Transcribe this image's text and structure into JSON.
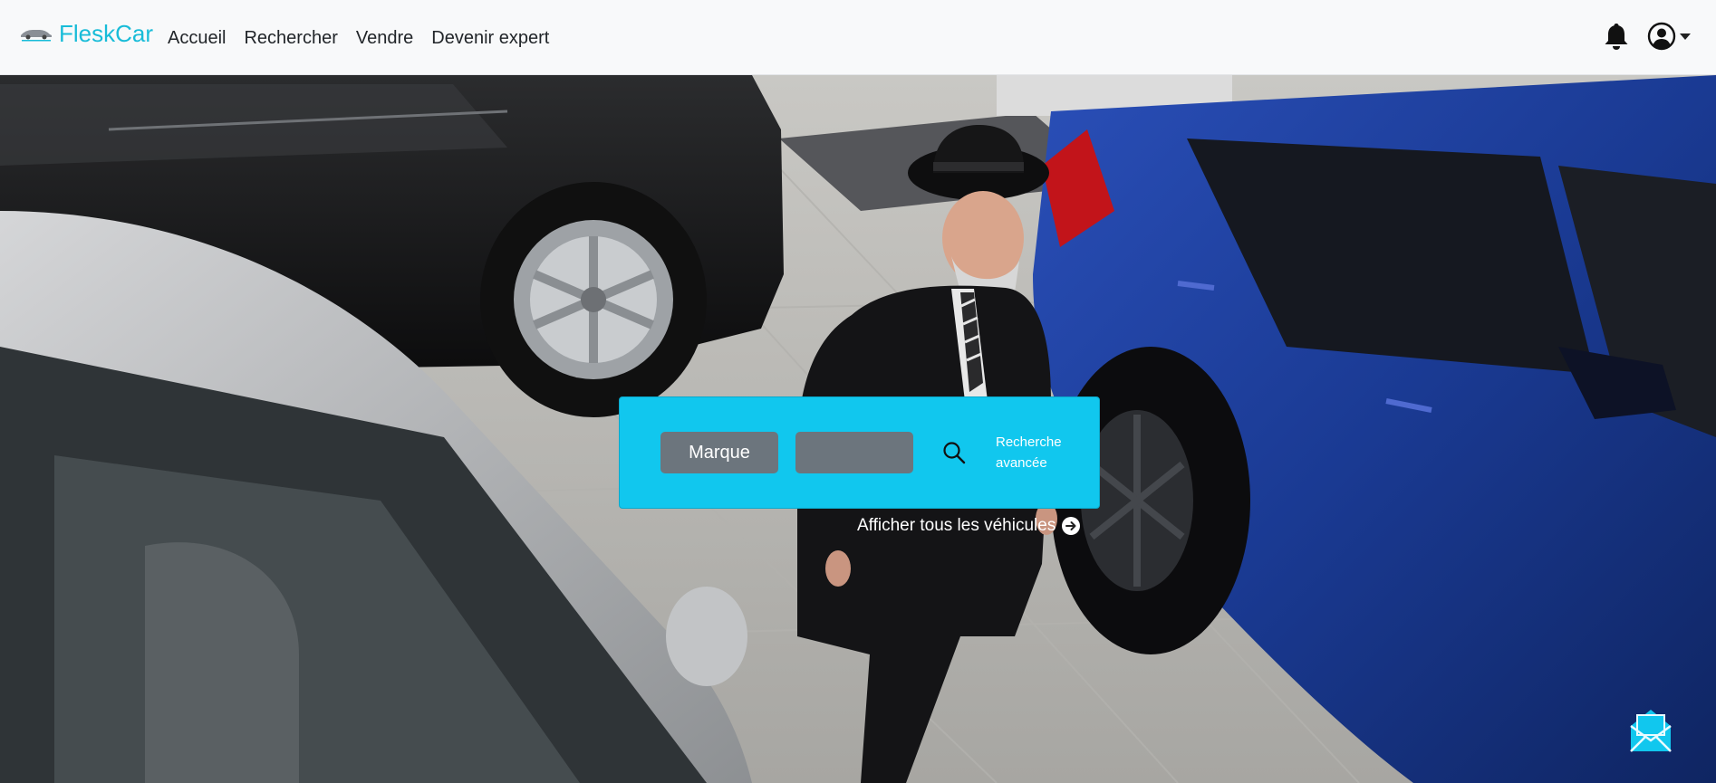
{
  "navbar": {
    "brand": "FleskCar",
    "links": [
      "Accueil",
      "Rechercher",
      "Vendre",
      "Devenir expert"
    ]
  },
  "search": {
    "brand_select": "Marque",
    "model_select": "",
    "advanced_link": "Recherche avancée"
  },
  "show_all_link": "Afficher tous les véhicules",
  "colors": {
    "accent": "#11c7ee",
    "brand_text": "#18bcd8",
    "select_bg": "#6c757d",
    "navbar_bg": "#f8f9fa"
  },
  "icons": {
    "bell": "bell-icon",
    "user": "user-circle-icon",
    "search": "search-icon",
    "arrow": "arrow-right-circle-icon",
    "mail": "envelope-open-icon"
  }
}
